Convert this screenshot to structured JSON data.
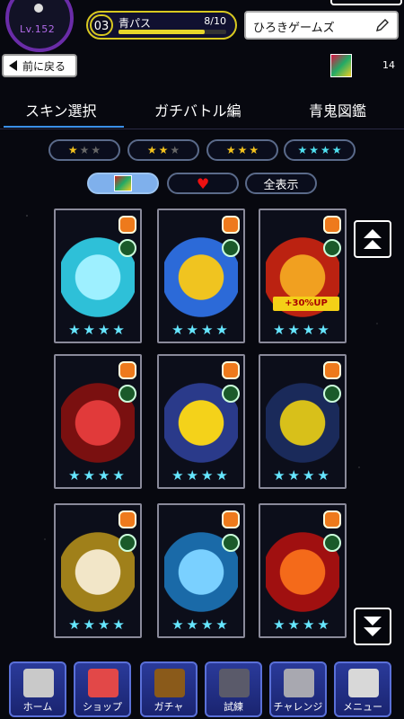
{
  "status": {
    "level": "Lv.152",
    "pass_number": "03",
    "pass_name": "青パス",
    "pass_progress_text": "8/10",
    "pass_progress": 0.8,
    "username": "ひろきゲームズ"
  },
  "nav": {
    "back_label": "前に戻る",
    "skin_count": "14"
  },
  "tabs": [
    {
      "label": "スキン選択",
      "active": true
    },
    {
      "label": "ガチバトル編",
      "active": false
    },
    {
      "label": "青鬼図鑑",
      "active": false
    }
  ],
  "star_filters": [
    {
      "filled": 1,
      "total": 3,
      "color": "#f3c21d"
    },
    {
      "filled": 2,
      "total": 3,
      "color": "#f3c21d"
    },
    {
      "filled": 3,
      "total": 3,
      "color": "#f3c21d"
    },
    {
      "filled": 4,
      "total": 4,
      "color": "#4fe0f0"
    }
  ],
  "secondary_filters": {
    "show_all_label": "全表示",
    "active": "skin"
  },
  "cards": [
    {
      "name": "whale",
      "stars": 4,
      "colors": [
        "#2ec0d8",
        "#9ef0ff"
      ]
    },
    {
      "name": "bear-snowflake",
      "stars": 4,
      "colors": [
        "#2c6ad8",
        "#f0c420"
      ]
    },
    {
      "name": "king-poop",
      "stars": 4,
      "colors": [
        "#b21",
        "#f1a020"
      ],
      "bonus": "+30%UP"
    },
    {
      "name": "red-dragon",
      "stars": 4,
      "colors": [
        "#7a1010",
        "#e13a3a"
      ]
    },
    {
      "name": "yellow-seal",
      "stars": 4,
      "colors": [
        "#2a3a8a",
        "#f4d21a"
      ]
    },
    {
      "name": "yellow-tank",
      "stars": 4,
      "colors": [
        "#1a2a5a",
        "#d8c01a"
      ]
    },
    {
      "name": "lightning-beast",
      "stars": 4,
      "colors": [
        "#a0801a",
        "#f2e6c8"
      ]
    },
    {
      "name": "water-serpent",
      "stars": 4,
      "colors": [
        "#1a6aa8",
        "#7ad0ff"
      ]
    },
    {
      "name": "fire-lion",
      "stars": 4,
      "colors": [
        "#a01010",
        "#f46a1a"
      ]
    }
  ],
  "bottom_nav": [
    {
      "label": "ホーム",
      "icon": "home-avatar-icon",
      "color": "#c9c9c9"
    },
    {
      "label": "ショップ",
      "icon": "shop-icon",
      "color": "#e24848"
    },
    {
      "label": "ガチャ",
      "icon": "gacha-icon",
      "color": "#8a5a1a"
    },
    {
      "label": "試練",
      "icon": "castle-icon",
      "color": "#5a5a6a"
    },
    {
      "label": "チャレンジ",
      "icon": "trophy-icon",
      "color": "#a8a8b0"
    },
    {
      "label": "メニュー",
      "icon": "menu-note-icon",
      "color": "#d8d8d8"
    }
  ]
}
